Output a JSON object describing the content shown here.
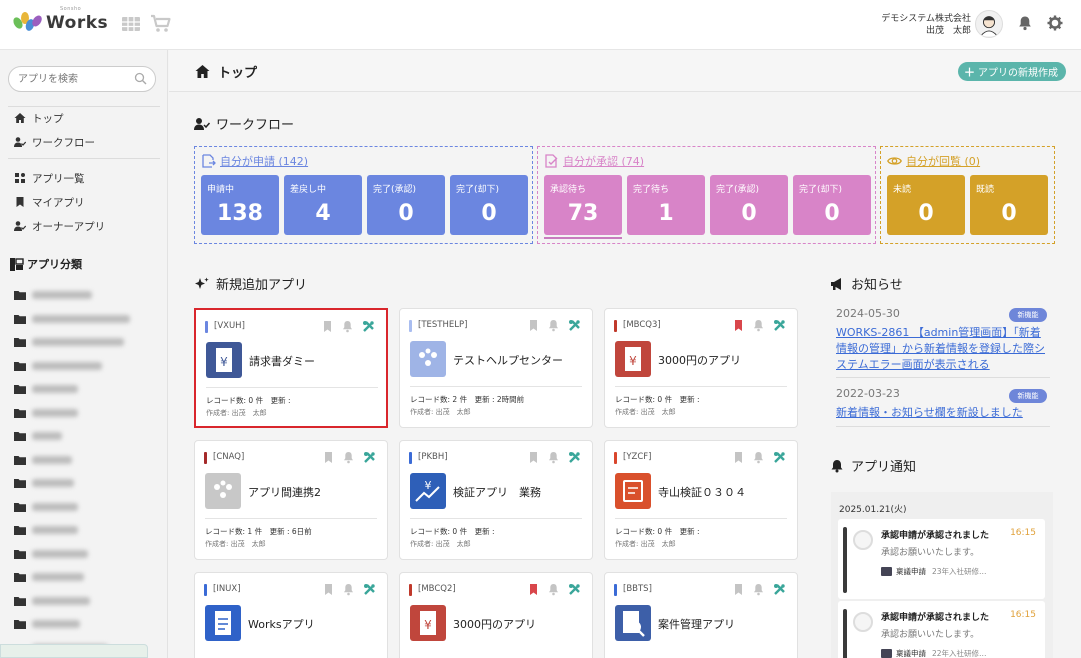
{
  "header": {
    "logo_sub": "Sonsho",
    "logo_word": "Works",
    "company": "デモシステム株式会社",
    "user": "出茂　太郎",
    "colors": {
      "logo_green": "#6bbf59",
      "logo_blue": "#4a8fd6",
      "logo_purple": "#9b5fbf",
      "logo_yellow": "#e8b63a"
    }
  },
  "sidebar": {
    "search_placeholder": "アプリを検索",
    "nav": [
      {
        "label": "トップ",
        "icon": "home-icon"
      },
      {
        "label": "ワークフロー",
        "icon": "user-check-icon"
      },
      {
        "label": "アプリ一覧",
        "icon": "grid-icon"
      },
      {
        "label": "マイアプリ",
        "icon": "bookmark-icon"
      },
      {
        "label": "オーナーアプリ",
        "icon": "user-check-icon"
      }
    ],
    "category_title": "アプリ分類"
  },
  "main": {
    "title": "トップ",
    "new_app_button": "アプリの新規作成",
    "workflow_title": "ワークフロー",
    "workflow": [
      {
        "label": "自分が申請 (142)",
        "color": "#6b86e0",
        "tiles": [
          {
            "label": "申請中",
            "value": "138"
          },
          {
            "label": "差戻し中",
            "value": "4"
          },
          {
            "label": "完了(承認)",
            "value": "0"
          },
          {
            "label": "完了(却下)",
            "value": "0"
          }
        ]
      },
      {
        "label": "自分が承認 (74)",
        "color": "#d884c8",
        "tiles": [
          {
            "label": "承認待ち",
            "value": "73"
          },
          {
            "label": "完了待ち",
            "value": "1"
          },
          {
            "label": "完了(承認)",
            "value": "0"
          },
          {
            "label": "完了(却下)",
            "value": "0"
          }
        ]
      },
      {
        "label": "自分が回覧 (0)",
        "color": "#d4a128",
        "tiles": [
          {
            "label": "未読",
            "value": "0"
          },
          {
            "label": "既読",
            "value": "0"
          }
        ]
      }
    ],
    "new_apps_title": "新規追加アプリ",
    "apps": [
      {
        "code": "[VXUH]",
        "name": "請求書ダミー",
        "bar_color": "#6b86e0",
        "icon_color": "#3f5897",
        "bookmarked": false,
        "meta": "レコード数: 0 件　更新 :",
        "author": "作成者: 出茂　太郎"
      },
      {
        "code": "[TESTHELP]",
        "name": "テストヘルプセンター",
        "bar_color": "#a9bdf0",
        "icon_color": "#9fb4e6",
        "bookmarked": false,
        "meta": "レコード数: 2 件　更新 : 2時間前",
        "author": "作成者: 出茂　太郎"
      },
      {
        "code": "[MBCQ3]",
        "name": "3000円のアプリ",
        "bar_color": "#c0392b",
        "icon_color": "#c0463c",
        "bookmarked": true,
        "meta": "レコード数: 0 件　更新 :",
        "author": "作成者: 出茂　太郎"
      },
      {
        "code": "[CNAQ]",
        "name": "アプリ間連携2",
        "bar_color": "#a52a2a",
        "icon_color": "#c8c8c8",
        "bookmarked": false,
        "meta": "レコード数: 1 件　更新 : 6日前",
        "author": "作成者: 出茂　太郎"
      },
      {
        "code": "[PKBH]",
        "name": "検証アプリ　業務",
        "bar_color": "#3b6bd6",
        "icon_color": "#2e5fb8",
        "bookmarked": false,
        "meta": "レコード数: 0 件　更新 :",
        "author": "作成者: 出茂　太郎"
      },
      {
        "code": "[YZCF]",
        "name": "寺山検証０３０４",
        "bar_color": "#d9462c",
        "icon_color": "#d9502c",
        "bookmarked": false,
        "meta": "レコード数: 0 件　更新 :",
        "author": "作成者: 出茂　太郎"
      },
      {
        "code": "[INUX]",
        "name": "Worksアプリ",
        "bar_color": "#3b6bd6",
        "icon_color": "#2f62c8",
        "bookmarked": false,
        "meta": "",
        "author": ""
      },
      {
        "code": "[MBCQ2]",
        "name": "3000円のアプリ",
        "bar_color": "#c0392b",
        "icon_color": "#c0463c",
        "bookmarked": true,
        "meta": "",
        "author": ""
      },
      {
        "code": "[BBTS]",
        "name": "案件管理アプリ",
        "bar_color": "#3b6bd6",
        "icon_color": "#3d5fa8",
        "bookmarked": false,
        "meta": "",
        "author": ""
      }
    ],
    "news_title": "お知らせ",
    "news": [
      {
        "date": "2024-05-30",
        "badge": "新機能",
        "text": "WORKS-2861 【admin管理画面】「新着情報の管理」から新着情報を登録した際システムエラー画面が表示される"
      },
      {
        "date": "2022-03-23",
        "badge": "新機能",
        "text": "新着情報・お知らせ欄を新設しました"
      }
    ],
    "notif_title": "アプリ通知",
    "notif_date": "2025.01.21(火)",
    "notifications": [
      {
        "title": "承認申請が承認されました",
        "time": "16:15",
        "message": "承認お願いいたします。",
        "source": "稟議申請",
        "sub": "23年入社研修…"
      },
      {
        "title": "承認申請が承認されました",
        "time": "16:15",
        "message": "承認お願いいたします。",
        "source": "稟議申請",
        "sub": "22年入社研修…"
      }
    ]
  }
}
